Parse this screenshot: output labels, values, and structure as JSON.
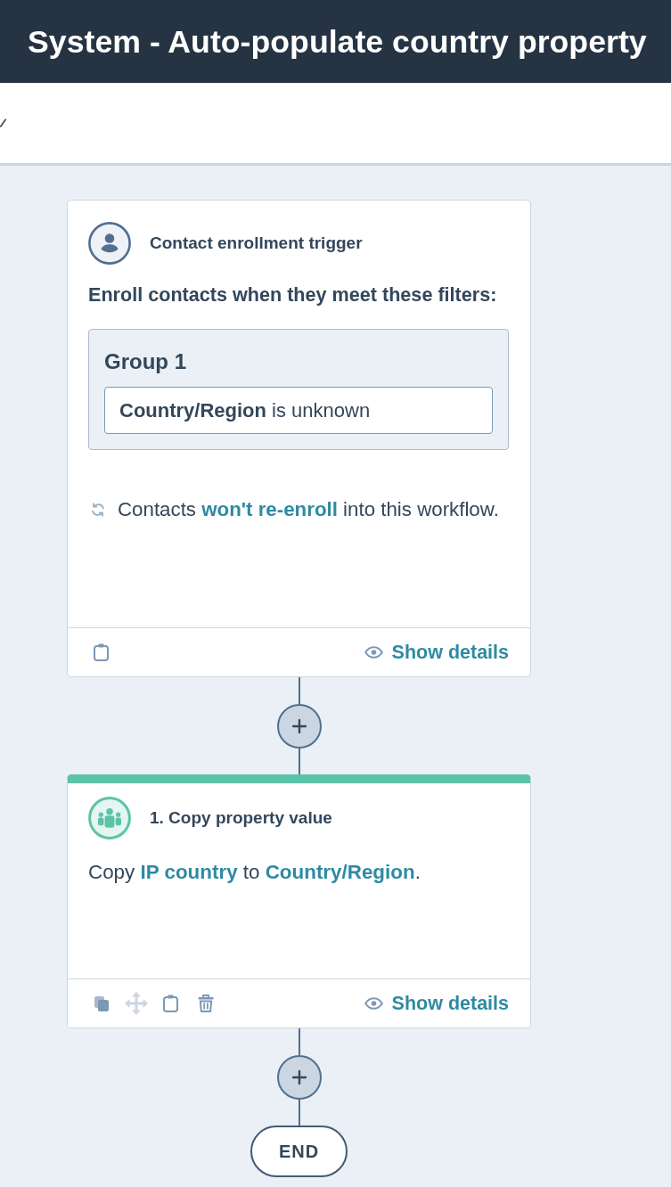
{
  "title_bar": {
    "title": "System - Auto-populate country property"
  },
  "trigger": {
    "title": "Contact enrollment trigger",
    "description": "Enroll contacts when they meet these filters:",
    "groups": [
      {
        "title": "Group 1",
        "filters": [
          "**Country/Region** is unknown"
        ]
      }
    ],
    "reenroll": [
      {
        "kind": "text",
        "text": "Contacts "
      },
      {
        "kind": "link",
        "text": "won't re-enroll"
      },
      {
        "kind": "text",
        "text": " into this workflow."
      }
    ],
    "tools": [
      {
        "kind": "paste",
        "disabled": false
      }
    ],
    "details_button": "Show details"
  },
  "actions": [
    {
      "title": "1. Copy property value",
      "summary": [
        {
          "kind": "text",
          "text": "Copy "
        },
        {
          "kind": "link",
          "text": "IP country"
        },
        {
          "kind": "text",
          "text": " to "
        },
        {
          "kind": "link",
          "text": "Country/Region"
        },
        {
          "kind": "text",
          "text": "."
        }
      ],
      "tools": [
        {
          "kind": "copy",
          "disabled": false
        },
        {
          "kind": "move",
          "disabled": true
        },
        {
          "kind": "paste",
          "disabled": false
        },
        {
          "kind": "delete",
          "disabled": false
        }
      ],
      "details_button": "Show details"
    }
  ],
  "end": {
    "label": "END"
  }
}
